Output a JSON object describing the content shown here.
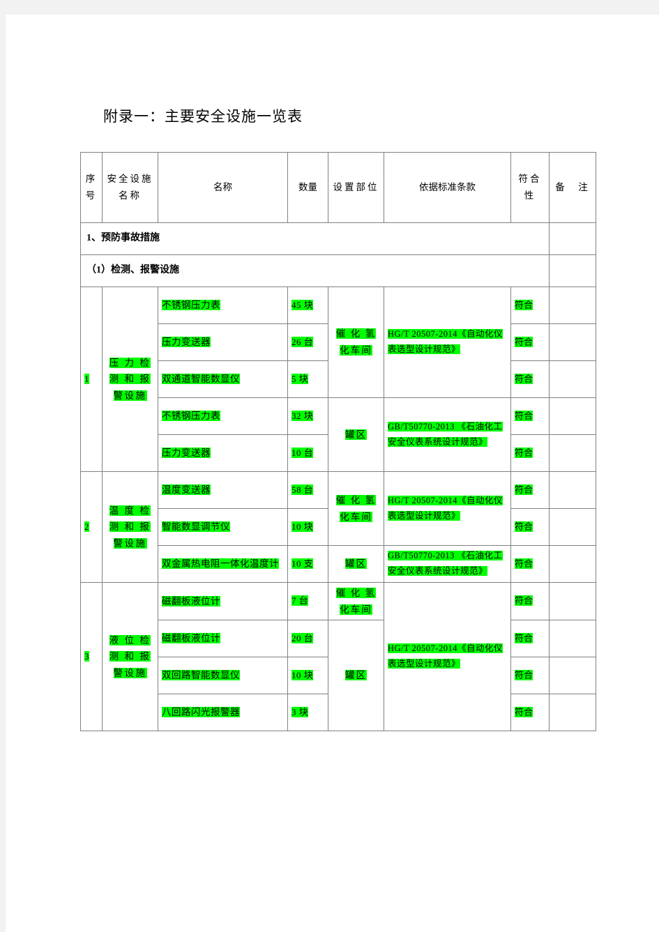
{
  "document": {
    "title": "附录一：主要安全设施一览表"
  },
  "table": {
    "headers": {
      "index": "序号",
      "facility_name": "安全设施名称",
      "name": "名称",
      "quantity": "数量",
      "location": "设置部位",
      "standard": "依据标准条款",
      "conformity": "符合性",
      "remark": "备　注"
    },
    "sections": [
      {
        "label": "1、预防事故措施"
      },
      {
        "label": "（1）检测、报警设施"
      }
    ],
    "groups": [
      {
        "index": "1",
        "facility_name": "压 力 检 测 和 报 警设施",
        "standards": [
          {
            "text": "HG/T 20507-2014《自动化仪表选型设计规范》",
            "rows": 3
          },
          {
            "text": "GB/T50770-2013 《石油化工安全仪表系统设计规范》",
            "rows": 2
          }
        ],
        "locations": [
          {
            "text": "催 化 氢化车间",
            "rows": 3
          },
          {
            "text": "罐区",
            "rows": 2
          }
        ],
        "items": [
          {
            "name": "不锈钢压力表",
            "qty": "45 块",
            "conformity": "符合",
            "remark": ""
          },
          {
            "name": "压力变送器",
            "qty": "26 台",
            "conformity": "符合",
            "remark": ""
          },
          {
            "name": "双通道智能数显仪",
            "qty": "5 块",
            "conformity": "符合",
            "remark": ""
          },
          {
            "name": "不锈钢压力表",
            "qty": "32 块",
            "conformity": "符合",
            "remark": ""
          },
          {
            "name": "压力变送器",
            "qty": "10 台",
            "conformity": "符合",
            "remark": ""
          }
        ]
      },
      {
        "index": "2",
        "facility_name": "温 度 检 测 和 报 警设施",
        "standards": [
          {
            "text": "HG/T 20507-2014《自动化仪表选型设计规范》",
            "rows": 2
          },
          {
            "text": "GB/T50770-2013 《石油化工安全仪表系统设计规范》",
            "rows": 1
          }
        ],
        "locations": [
          {
            "text": "催 化 氢化车间",
            "rows": 2
          },
          {
            "text": "罐区",
            "rows": 1
          }
        ],
        "items": [
          {
            "name": "温度变送器",
            "qty": "58 台",
            "conformity": "符合",
            "remark": ""
          },
          {
            "name": "智能数显调节仪",
            "qty": "10 块",
            "conformity": "符合",
            "remark": ""
          },
          {
            "name": "双金属热电阻一体化温度计",
            "qty": "10 支",
            "conformity": "符合",
            "remark": ""
          }
        ]
      },
      {
        "index": "3",
        "facility_name": "液 位 检 测 和 报 警设施",
        "standards": [
          {
            "text": "HG/T 20507-2014《自动化仪表选型设计规范》",
            "rows": 4
          }
        ],
        "locations": [
          {
            "text": "催 化 氢化车间",
            "rows": 1
          },
          {
            "text": "罐区",
            "rows": 3
          }
        ],
        "items": [
          {
            "name": "磁翻板液位计",
            "qty": "7 台",
            "conformity": "符合",
            "remark": ""
          },
          {
            "name": "磁翻板液位计",
            "qty": "20 台",
            "conformity": "符合",
            "remark": ""
          },
          {
            "name": "双回路智能数显仪",
            "qty": "10 块",
            "conformity": "符合",
            "remark": ""
          },
          {
            "name": "八回路闪光报警器",
            "qty": "3 块",
            "conformity": "符合",
            "remark": ""
          }
        ]
      }
    ]
  },
  "colors": {
    "highlight": "#00ff00",
    "border": "#808080",
    "page": "#ffffff"
  }
}
